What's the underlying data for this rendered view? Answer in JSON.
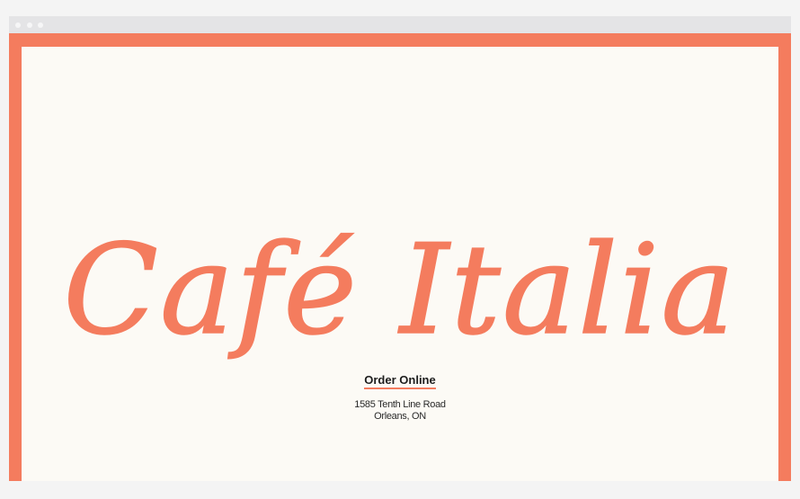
{
  "site": {
    "name": "Café Italia",
    "order_label": "Order Online",
    "address_line1": "1585 Tenth Line Road",
    "address_line2": "Orleans, ON"
  },
  "colors": {
    "accent": "#f47c5e",
    "background": "#fcfaf5",
    "text": "#1d1d1d",
    "chrome": "#e4e4e6"
  },
  "icons": [
    "window-dot",
    "window-dot",
    "window-dot"
  ]
}
